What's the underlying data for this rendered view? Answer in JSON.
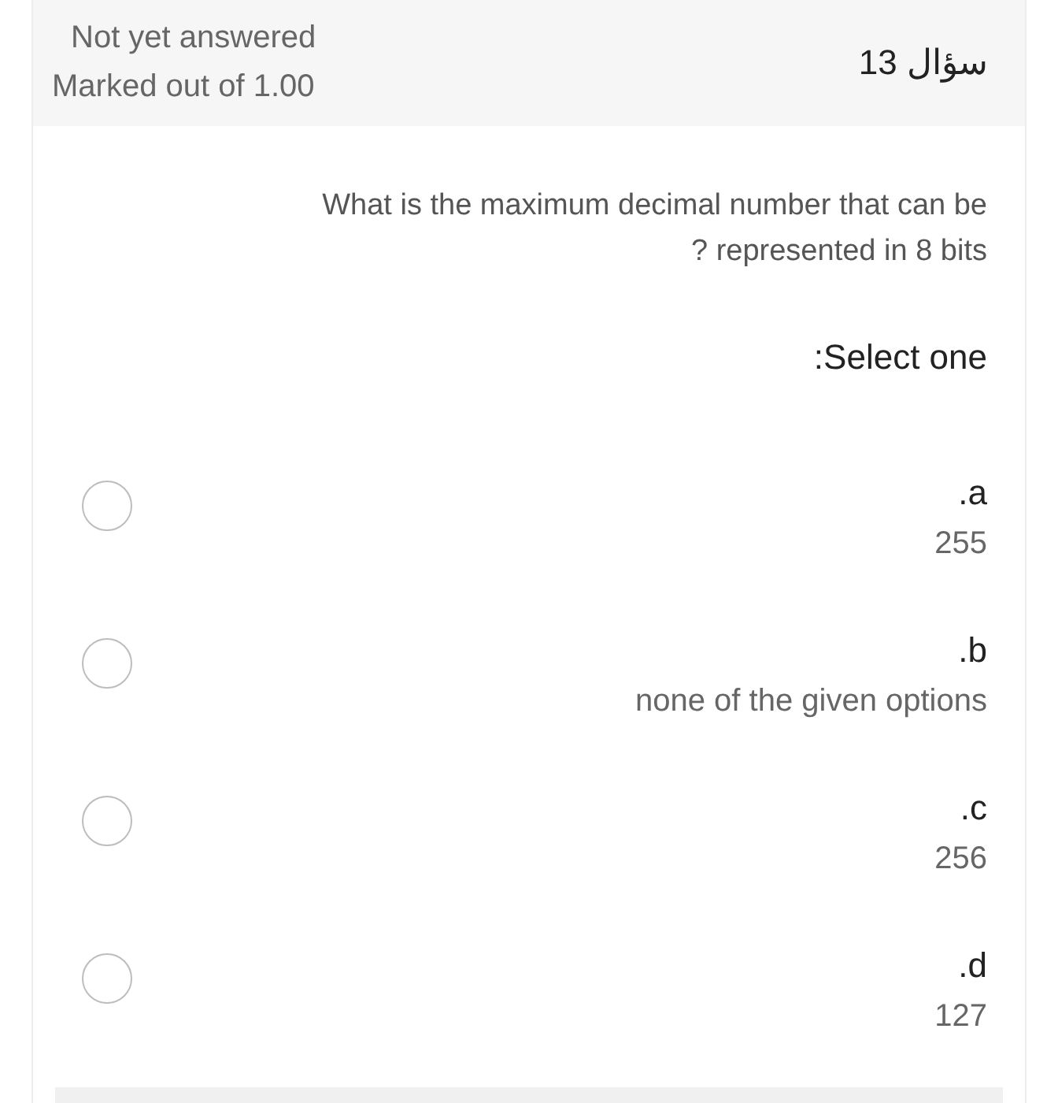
{
  "header": {
    "state": "Not yet answered",
    "marks": "Marked out of 1.00",
    "question_number": "سؤال 13"
  },
  "question": {
    "text": "What is the maximum decimal number that can be\n? represented in 8 bits",
    "prompt": ":Select one"
  },
  "options": [
    {
      "letter": ".a",
      "answer": "255",
      "selected": false
    },
    {
      "letter": ".b",
      "answer": "none of the given options",
      "selected": false
    },
    {
      "letter": ".c",
      "answer": "256",
      "selected": false
    },
    {
      "letter": ".d",
      "answer": "127",
      "selected": false
    }
  ]
}
